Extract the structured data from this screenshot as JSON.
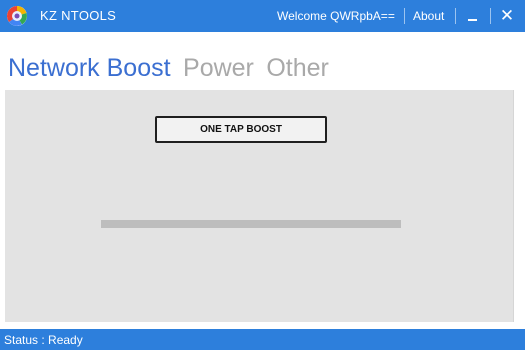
{
  "app": {
    "title": "KZ NTOOLS",
    "welcome_text": "Welcome QWRpbA==",
    "about_label": "About",
    "accent_color": "#2d7fdc"
  },
  "window_controls": {
    "minimize_icon": "minimize-icon",
    "close_glyph": "✕"
  },
  "tabs": [
    {
      "label": "Network Boost",
      "active": true
    },
    {
      "label": "Power",
      "active": false
    },
    {
      "label": "Other",
      "active": false
    }
  ],
  "main": {
    "boost_button_label": "ONE TAP BOOST",
    "progress_fraction": 0
  },
  "status": {
    "text": "Status : Ready"
  }
}
